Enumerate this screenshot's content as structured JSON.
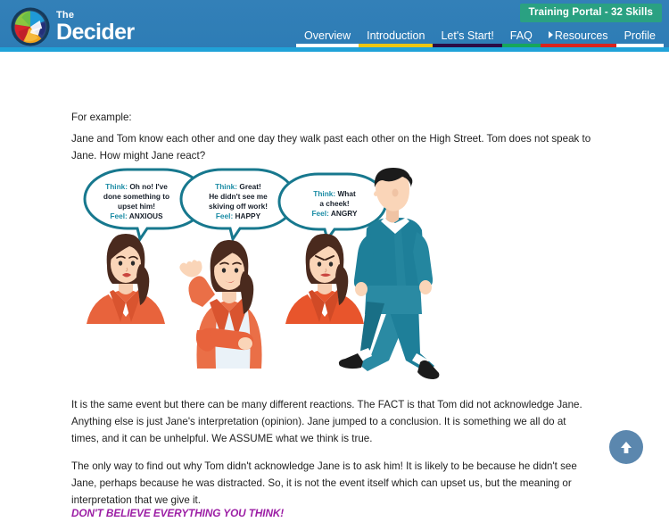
{
  "header": {
    "background_color": "#2e7fb8",
    "logo": {
      "the": "The",
      "name": "Decider",
      "icon": "pinwheel-logo"
    },
    "portal_badge": {
      "label": "Training Portal - 32 Skills",
      "color": "#2aa182"
    },
    "nav": [
      {
        "label": "Overview",
        "underline_color": "#ffffff"
      },
      {
        "label": "Introduction",
        "underline_color": "#edc612"
      },
      {
        "label": "Let's Start!",
        "underline_color": "#2b0b45"
      },
      {
        "label": "FAQ",
        "underline_color": "#16a75c"
      },
      {
        "label": "Resources",
        "underline_color": "#d9231d",
        "caret": true
      },
      {
        "label": "Profile",
        "underline_color": "#ffffff"
      }
    ]
  },
  "content": {
    "for_example": "For example:",
    "intro": "Jane and Tom know each other and one day they walk past each other on the High Street. Tom does not speak to Jane. How might Jane react?",
    "same_event": "It is the same event but there can be many different reactions. The FACT is that Tom did not acknowledge Jane. Anything else is just Jane's interpretation (opinion). Jane jumped to a conclusion. It is something we all do at times, and it can be unhelpful. We ASSUME what we think is true.",
    "only_way": "The only way to find out why Tom didn't acknowledge Jane is to ask him! It is likely to be because he didn't see Jane, perhaps because he was distracted. So, it is not the event itself which can upset us, but the meaning or interpretation that we give it.",
    "dont_believe": "DON'T BELIEVE EVERYTHING YOU THINK!",
    "dont_believe_color": "#9c1fa5"
  },
  "illustration": {
    "bubbles": [
      {
        "think_label": "Think:",
        "think_text": "Oh no! I've done something to upset him!",
        "feel_label": "Feel:",
        "feel_text": "ANXIOUS",
        "lines": [
          "Think: Oh no! I've",
          "done something to",
          "upset him!",
          "Feel: ANXIOUS"
        ]
      },
      {
        "think_label": "Think:",
        "think_text": "Great! He didn't see me skiving off work!",
        "feel_label": "Feel:",
        "feel_text": "HAPPY",
        "lines": [
          "Think: Great!",
          "He didn't see me",
          "skiving off work!",
          "Feel: HAPPY"
        ]
      },
      {
        "think_label": "Think:",
        "think_text": "What a cheek!",
        "feel_label": "Feel:",
        "feel_text": "ANGRY",
        "lines": [
          "Think: What",
          "a cheek!",
          "Feel: ANGRY"
        ]
      }
    ],
    "bubble_stroke_color": "#17788e",
    "characters": [
      {
        "name": "woman-anxious",
        "outfit_color": "#e8633c",
        "hair_color": "#4a2a1e"
      },
      {
        "name": "woman-happy",
        "outfit_color": "#ea6f47",
        "hair_color": "#4a2a1e"
      },
      {
        "name": "woman-angry",
        "outfit_color": "#e8552c",
        "hair_color": "#4a2a1e"
      },
      {
        "name": "man-walking",
        "outfit_color": "#1e7f99",
        "hair_color": "#1b1b1b"
      }
    ]
  },
  "scroll_top": {
    "label": "Back to top",
    "color": "#5b87ae"
  }
}
